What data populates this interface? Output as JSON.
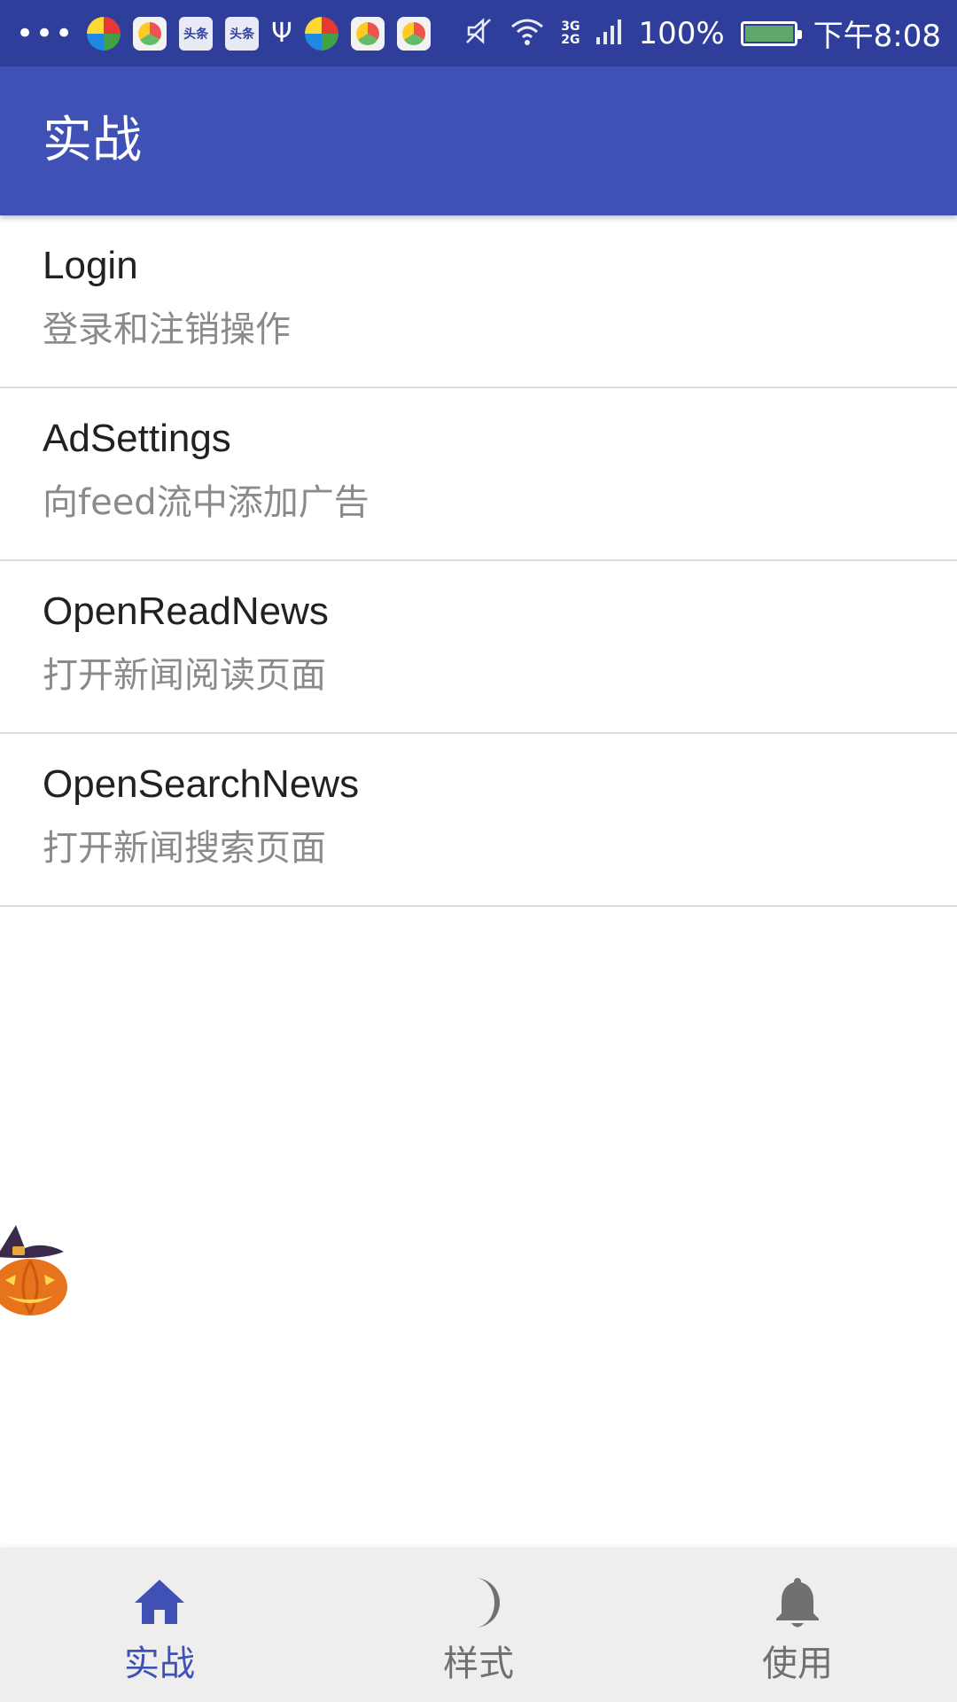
{
  "status_bar": {
    "overflow_indicator": "•••",
    "notification_icons": [
      "pin-app-icon",
      "ball-app-icon",
      "news-app-icon",
      "news-app-icon",
      "usb-icon",
      "pin-app-icon",
      "ball-app-icon",
      "ball-app-icon"
    ],
    "news_badge_text": "头条",
    "network_type_top": "3G",
    "network_type_bottom": "2G",
    "battery_percent": "100%",
    "battery_level": 1.0,
    "time": "下午8:08"
  },
  "app_bar": {
    "title": "实战",
    "color": "#3f51b5"
  },
  "list": {
    "items": [
      {
        "title": "Login",
        "subtitle": "登录和注销操作"
      },
      {
        "title": "AdSettings",
        "subtitle": "向feed流中添加广告"
      },
      {
        "title": "OpenReadNews",
        "subtitle": "打开新闻阅读页面"
      },
      {
        "title": "OpenSearchNews",
        "subtitle": "打开新闻搜索页面"
      }
    ]
  },
  "floating_sticker": {
    "icon": "halloween-pumpkin-icon"
  },
  "bottom_nav": {
    "active_color": "#3f51b5",
    "inactive_color": "#707070",
    "tabs": [
      {
        "label": "实战",
        "icon": "home-icon",
        "active": true
      },
      {
        "label": "样式",
        "icon": "moon-icon",
        "active": false
      },
      {
        "label": "使用",
        "icon": "bell-icon",
        "active": false
      }
    ]
  }
}
